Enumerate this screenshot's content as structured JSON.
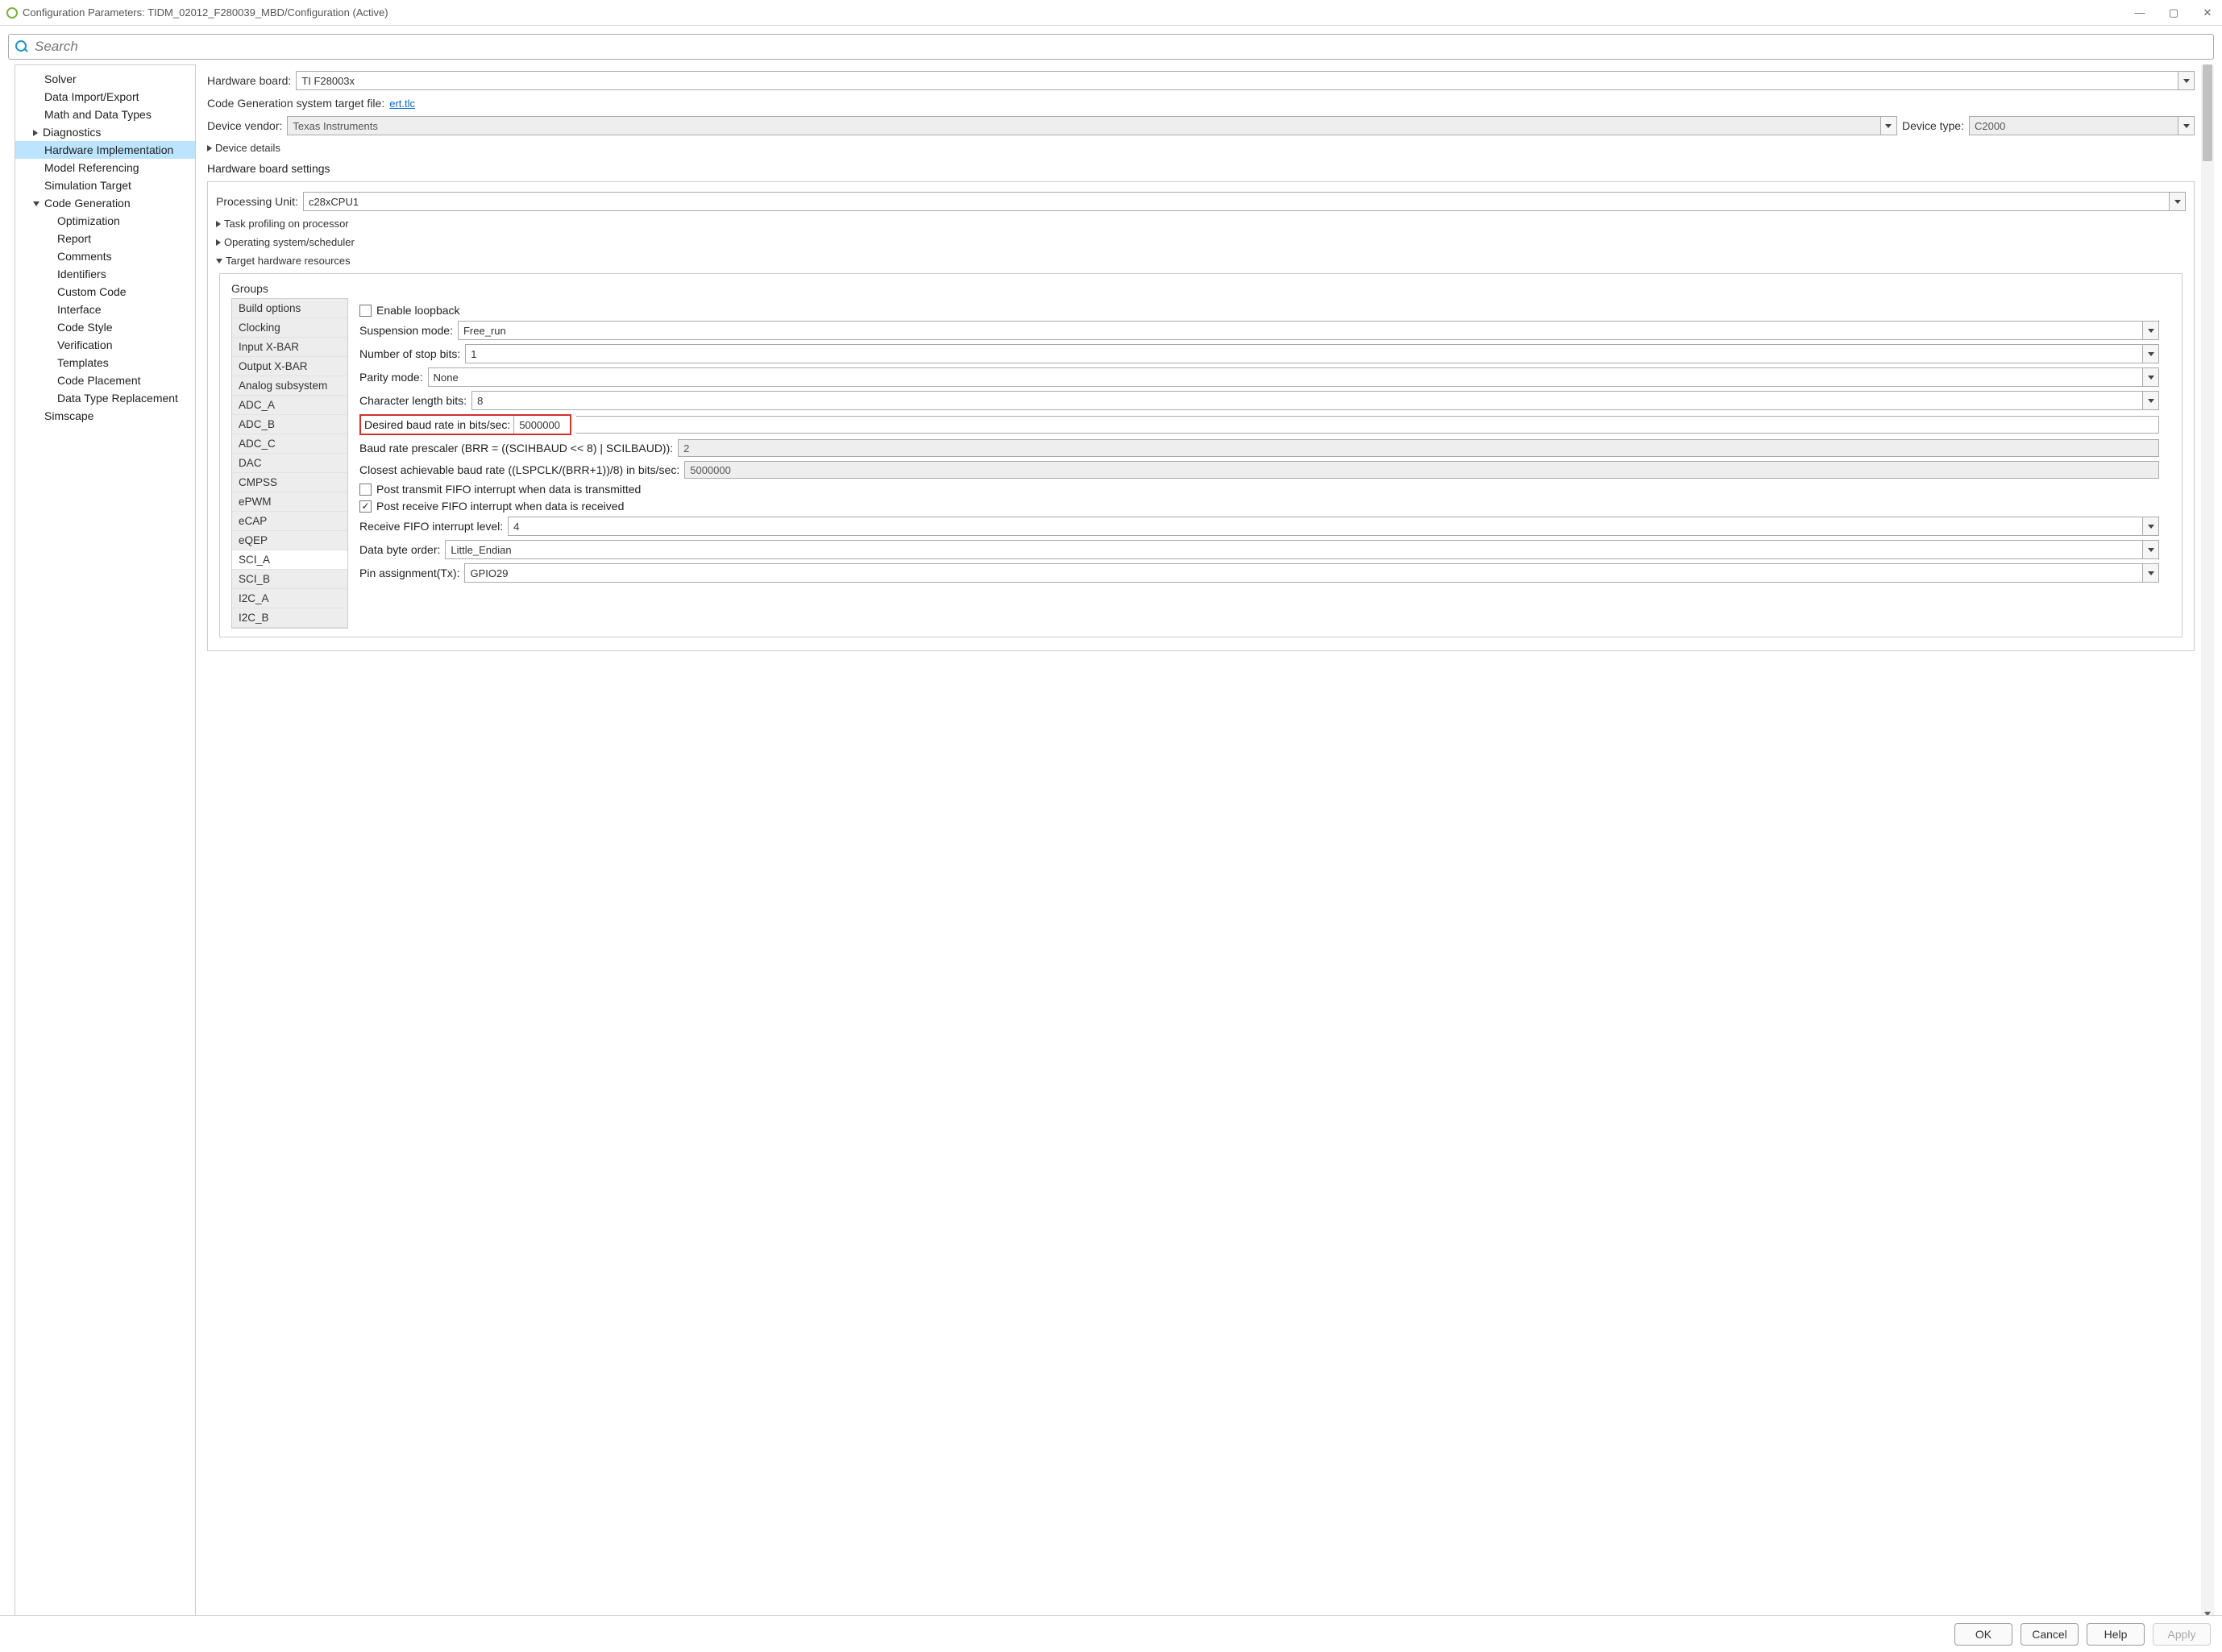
{
  "window": {
    "title": "Configuration Parameters: TIDM_02012_F280039_MBD/Configuration (Active)"
  },
  "search": {
    "placeholder": "Search"
  },
  "tree": {
    "items": [
      {
        "label": "Solver",
        "lvl": "top"
      },
      {
        "label": "Data Import/Export",
        "lvl": "top"
      },
      {
        "label": "Math and Data Types",
        "lvl": "top"
      },
      {
        "label": "Diagnostics",
        "lvl": "top",
        "caret": "right"
      },
      {
        "label": "Hardware Implementation",
        "lvl": "top",
        "selected": true
      },
      {
        "label": "Model Referencing",
        "lvl": "top"
      },
      {
        "label": "Simulation Target",
        "lvl": "top"
      },
      {
        "label": "Code Generation",
        "lvl": "top",
        "caret": "down"
      },
      {
        "label": "Optimization",
        "lvl": "sub"
      },
      {
        "label": "Report",
        "lvl": "sub"
      },
      {
        "label": "Comments",
        "lvl": "sub"
      },
      {
        "label": "Identifiers",
        "lvl": "sub"
      },
      {
        "label": "Custom Code",
        "lvl": "sub"
      },
      {
        "label": "Interface",
        "lvl": "sub"
      },
      {
        "label": "Code Style",
        "lvl": "sub"
      },
      {
        "label": "Verification",
        "lvl": "sub"
      },
      {
        "label": "Templates",
        "lvl": "sub"
      },
      {
        "label": "Code Placement",
        "lvl": "sub"
      },
      {
        "label": "Data Type Replacement",
        "lvl": "sub"
      },
      {
        "label": "Simscape",
        "lvl": "top"
      }
    ]
  },
  "main": {
    "hw_board_label": "Hardware board:",
    "hw_board_value": "TI F28003x",
    "codegen_label": "Code Generation system target file:",
    "codegen_link": "ert.tlc",
    "dev_vendor_label": "Device vendor:",
    "dev_vendor_value": "Texas Instruments",
    "dev_type_label": "Device type:",
    "dev_type_value": "C2000",
    "device_details": "Device details",
    "hw_settings_header": "Hardware board settings",
    "proc_unit_label": "Processing Unit:",
    "proc_unit_value": "c28xCPU1",
    "task_profiling": "Task profiling on processor",
    "os_scheduler": "Operating system/scheduler",
    "target_hw": "Target hardware resources",
    "groups_label": "Groups"
  },
  "groups": [
    "Build options",
    "Clocking",
    "Input X-BAR",
    "Output X-BAR",
    "Analog subsystem",
    "ADC_A",
    "ADC_B",
    "ADC_C",
    "DAC",
    "CMPSS",
    "ePWM",
    "eCAP",
    "eQEP",
    "SCI_A",
    "SCI_B",
    "I2C_A",
    "I2C_B"
  ],
  "groups_selected": "SCI_A",
  "props": {
    "enable_loopback": {
      "label": "Enable loopback",
      "checked": false
    },
    "suspension_label": "Suspension mode:",
    "suspension_value": "Free_run",
    "stopbits_label": "Number of stop bits:",
    "stopbits_value": "1",
    "parity_label": "Parity mode:",
    "parity_value": "None",
    "charlen_label": "Character length bits:",
    "charlen_value": "8",
    "baud_label": "Desired baud rate in bits/sec:",
    "baud_value": "5000000",
    "prescaler_label": "Baud rate prescaler (BRR = ((SCIHBAUD << 8) | SCILBAUD)):",
    "prescaler_value": "2",
    "closest_label": "Closest achievable baud rate ((LSPCLK/(BRR+1))/8) in bits/sec:",
    "closest_value": "5000000",
    "post_tx": {
      "label": "Post transmit FIFO interrupt when data is transmitted",
      "checked": false
    },
    "post_rx": {
      "label": "Post receive FIFO interrupt when data is received",
      "checked": true
    },
    "rx_fifo_label": "Receive FIFO interrupt level:",
    "rx_fifo_value": "4",
    "byteorder_label": "Data byte order:",
    "byteorder_value": "Little_Endian",
    "pintx_label": "Pin assignment(Tx):",
    "pintx_value": "GPIO29"
  },
  "footer": {
    "ok": "OK",
    "cancel": "Cancel",
    "help": "Help",
    "apply": "Apply"
  }
}
